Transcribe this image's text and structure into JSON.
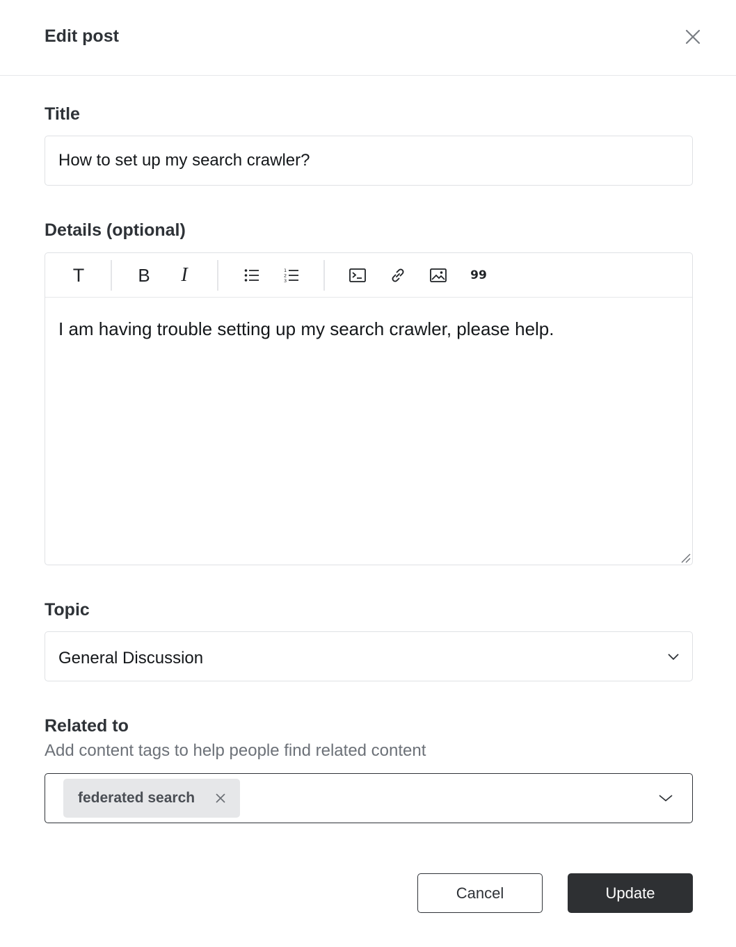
{
  "dialog": {
    "title": "Edit post"
  },
  "title_field": {
    "label": "Title",
    "value": "How to set up my search crawler?"
  },
  "details_field": {
    "label": "Details (optional)",
    "toolbar": {
      "text_glyph": "T",
      "bold_glyph": "B",
      "italic_glyph": "I",
      "quote_glyph": "99"
    },
    "body": "I am having trouble setting up my search crawler, please help."
  },
  "topic_field": {
    "label": "Topic",
    "selected": "General Discussion"
  },
  "related_field": {
    "label": "Related to",
    "hint": "Add content tags to help people find related content",
    "tags": [
      {
        "label": "federated search"
      }
    ]
  },
  "actions": {
    "cancel_label": "Cancel",
    "update_label": "Update"
  },
  "icons": {
    "close": "close-icon",
    "bullet_list": "bullet-list-icon",
    "numbered_list": "numbered-list-icon",
    "code": "code-block-icon",
    "link": "link-icon",
    "image": "image-icon",
    "quote": "quote-icon",
    "chevron": "chevron-down-icon",
    "tag_remove": "tag-remove-icon"
  },
  "colors": {
    "primary_button": "#2e3033",
    "text_dark": "#2e3237",
    "border": "#dfe1e4",
    "tag_bg": "#e6e7e9",
    "hint_text": "#6c7178"
  }
}
